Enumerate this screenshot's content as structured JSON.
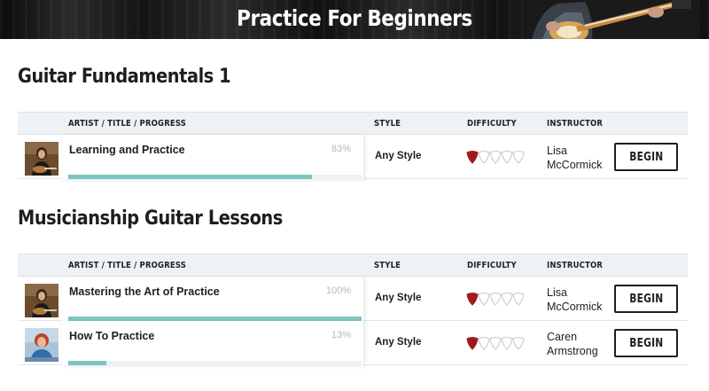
{
  "banner": {
    "title": "Practice For Beginners"
  },
  "table_headers": {
    "artist_title_progress": "ARTIST / TITLE / PROGRESS",
    "style": "STYLE",
    "difficulty": "DIFFICULTY",
    "instructor": "INSTRUCTOR"
  },
  "sections": [
    {
      "title": "Guitar Fundamentals 1",
      "lessons": [
        {
          "title": "Learning and Practice",
          "progress_label": "83%",
          "progress": 0.83,
          "style": "Any Style",
          "difficulty": 1,
          "difficulty_max": 5,
          "instructor_first": "Lisa",
          "instructor_last": "McCormick",
          "button": "BEGIN"
        }
      ]
    },
    {
      "title": "Musicianship Guitar Lessons",
      "lessons": [
        {
          "title": "Mastering the Art of Practice",
          "progress_label": "100%",
          "progress": 1.0,
          "style": "Any Style",
          "difficulty": 1,
          "difficulty_max": 5,
          "instructor_first": "Lisa",
          "instructor_last": "McCormick",
          "button": "BEGIN"
        },
        {
          "title": "How To Practice",
          "progress_label": "13%",
          "progress": 0.13,
          "style": "Any Style",
          "difficulty": 1,
          "difficulty_max": 5,
          "instructor_first": "Caren",
          "instructor_last": "Armstrong",
          "button": "BEGIN"
        }
      ]
    }
  ],
  "colors": {
    "progress_fill": "#7cc6bf",
    "pick_filled": "#a3191b",
    "pick_empty_stroke": "#c8c8c8",
    "header_strip": "#eef2f5"
  },
  "icons": {
    "difficulty_pick": "guitar-pick-icon",
    "thumbnail": "instructor-avatar"
  }
}
